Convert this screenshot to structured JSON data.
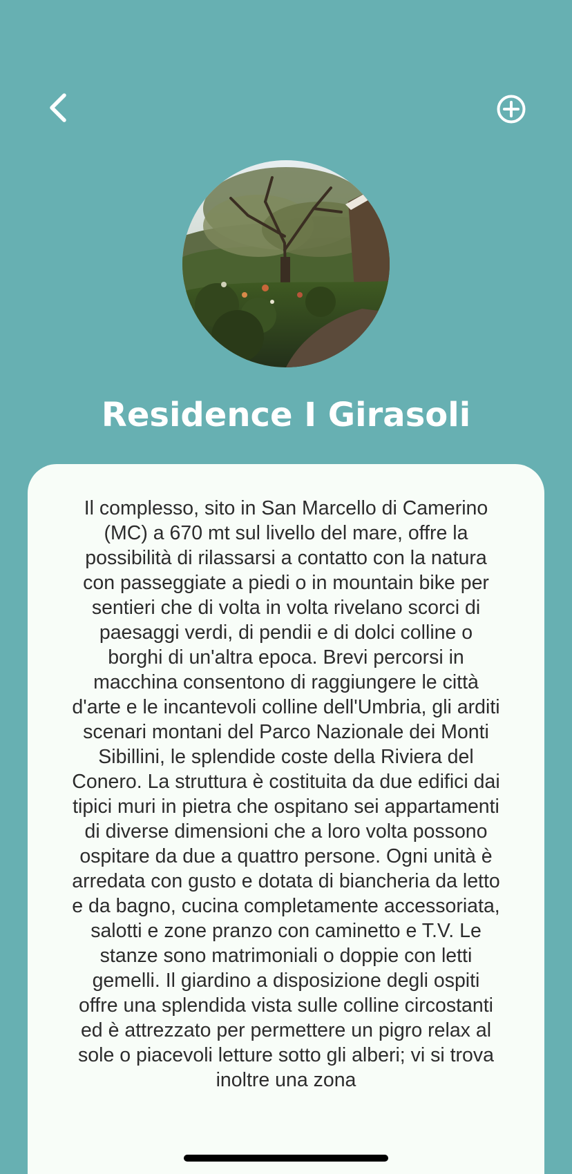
{
  "header": {
    "back_icon": "chevron-left-icon",
    "add_icon": "plus-circle-icon"
  },
  "hero": {
    "image": "garden-tree-photo"
  },
  "title": "Residence I Girasoli",
  "description": "Il complesso, sito in San Marcello di Camerino (MC) a 670 mt sul livello del mare, offre la possibilità di rilassarsi a contatto con la natura con passeggiate a piedi o in mountain bike per sentieri che di volta in volta rivelano scorci di paesaggi verdi, di pendii e di dolci colline o borghi di un'altra epoca. Brevi percorsi in macchina consentono di raggiungere le città d'arte e le incantevoli colline dell'Umbria, gli arditi scenari montani del Parco Nazionale dei Monti Sibillini, le splendide coste della Riviera del Conero. La struttura è costituita da due edifici dai tipici muri in pietra che ospitano sei appartamenti di diverse dimensioni che a loro volta possono ospitare da due a quattro persone. Ogni unità è arredata con gusto e dotata di biancheria da letto e da bagno, cucina completamente accessoriata, salotti e zone pranzo con caminetto e T.V. Le stanze sono matrimoniali o doppie con letti gemelli. Il giardino a disposizione degli ospiti offre una splendida vista sulle colline circostanti ed è attrezzato per permettere un pigro relax al sole o piacevoli letture sotto gli alberi; vi si trova inoltre una zona",
  "colors": {
    "background": "#67B0B2",
    "card": "#F8FDF8",
    "text": "#2C2C2C",
    "title": "#FFFFFF"
  }
}
